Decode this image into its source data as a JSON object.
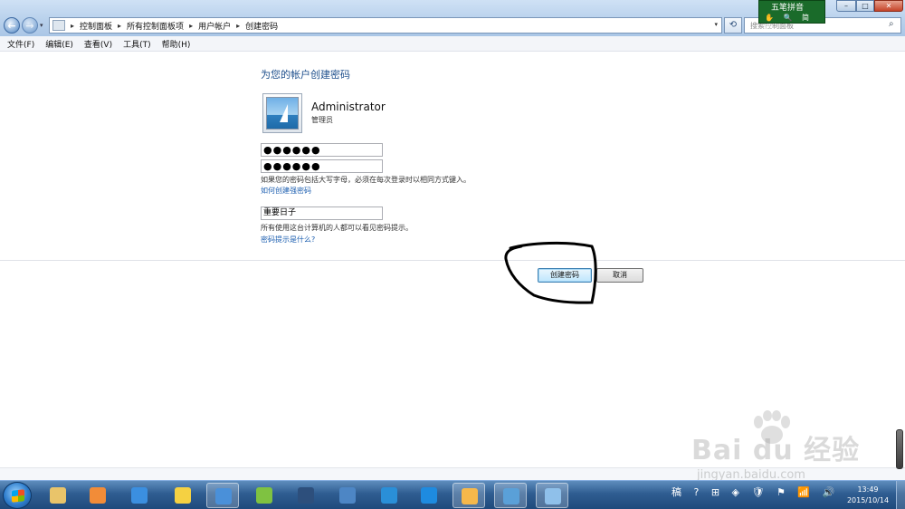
{
  "addressbar": {
    "crumbs": [
      "控制面板",
      "所有控制面板项",
      "用户帐户",
      "创建密码"
    ]
  },
  "search": {
    "placeholder": "搜索控制面板"
  },
  "ime": {
    "title": "五笔拼音",
    "row": "✋ 🔍 简 ⊞"
  },
  "menubar": {
    "items": [
      "文件(F)",
      "编辑(E)",
      "查看(V)",
      "工具(T)",
      "帮助(H)"
    ]
  },
  "main": {
    "title": "为您的帐户创建密码",
    "user_name": "Administrator",
    "user_role": "管理员",
    "password_value": "●●●●●●",
    "confirm_value": "●●●●●●",
    "caps_note": "如果您的密码包括大写字母，必须在每次登录时以相同方式键入。",
    "strong_link": "如何创建强密码",
    "hint_value": "重要日子",
    "hint_note": "所有使用这台计算机的人都可以看见密码提示。",
    "hint_link": "密码提示是什么?",
    "create_label": "创建密码",
    "cancel_label": "取消"
  },
  "watermark": {
    "logo": "Bai du 经验",
    "url": "jingyan.baidu.com"
  },
  "taskbar": {
    "apps": [
      {
        "name": "explorer",
        "color": "#e9c46a"
      },
      {
        "name": "media-player",
        "color": "#f28c38"
      },
      {
        "name": "xunlei",
        "color": "#3b8fe0"
      },
      {
        "name": "qq",
        "color": "#f5d142"
      },
      {
        "name": "sogou",
        "color": "#4a90d9"
      },
      {
        "name": "360-browser",
        "color": "#7fc241"
      },
      {
        "name": "film",
        "color": "#2d4f7c"
      },
      {
        "name": "network",
        "color": "#4d86c5"
      },
      {
        "name": "ie",
        "color": "#2a8fd8"
      },
      {
        "name": "browser-blue",
        "color": "#1e8be0"
      },
      {
        "name": "6plus1",
        "color": "#f6b84b"
      },
      {
        "name": "monitor",
        "color": "#5aa0d8"
      },
      {
        "name": "control-panel",
        "color": "#8fc0ea"
      }
    ],
    "tray_text": "稿 ? ⊞ ◈ 🛡 ⚑ 📶 🔊",
    "time": "13:49",
    "date": "2015/10/14"
  },
  "colors": {
    "link": "#1d5fb0",
    "title": "#1e4f8c",
    "taskbar": "#2f5d91"
  }
}
